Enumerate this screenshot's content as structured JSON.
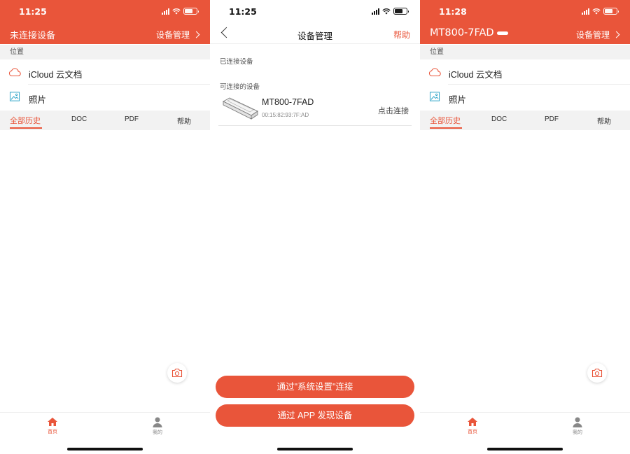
{
  "colors": {
    "accent": "#E9553A",
    "section_bg": "#f2f2f2"
  },
  "screens": {
    "home_disconnected": {
      "time": "11:25",
      "title": "未连接设备",
      "device_manage": "设备管理",
      "section_label": "位置",
      "rows": [
        {
          "label": "iCloud 云文档",
          "icon": "cloud-icon"
        },
        {
          "label": "照片",
          "icon": "photo-icon"
        }
      ],
      "tabs": [
        "全部历史",
        "DOC",
        "PDF",
        "帮助"
      ],
      "tabbar": {
        "home": "首页",
        "mine": "我的"
      }
    },
    "device_management": {
      "time": "11:25",
      "title": "设备管理",
      "help": "帮助",
      "connected_label": "已连接设备",
      "available_label": "可连接的设备",
      "device": {
        "name": "MT800-7FAD",
        "mac": "00:15:82:93:7F:AD",
        "action": "点击连接"
      },
      "buttons": {
        "system_settings": "通过\"系统设置\"连接",
        "app_discover": "通过 APP 发现设备"
      }
    },
    "home_connected": {
      "time": "11:28",
      "title": "MT800-7FAD",
      "device_manage": "设备管理",
      "section_label": "位置",
      "rows": [
        {
          "label": "iCloud 云文档",
          "icon": "cloud-icon"
        },
        {
          "label": "照片",
          "icon": "photo-icon"
        }
      ],
      "tabs": [
        "全部历史",
        "DOC",
        "PDF",
        "帮助"
      ],
      "tabbar": {
        "home": "首页",
        "mine": "我的"
      }
    }
  }
}
